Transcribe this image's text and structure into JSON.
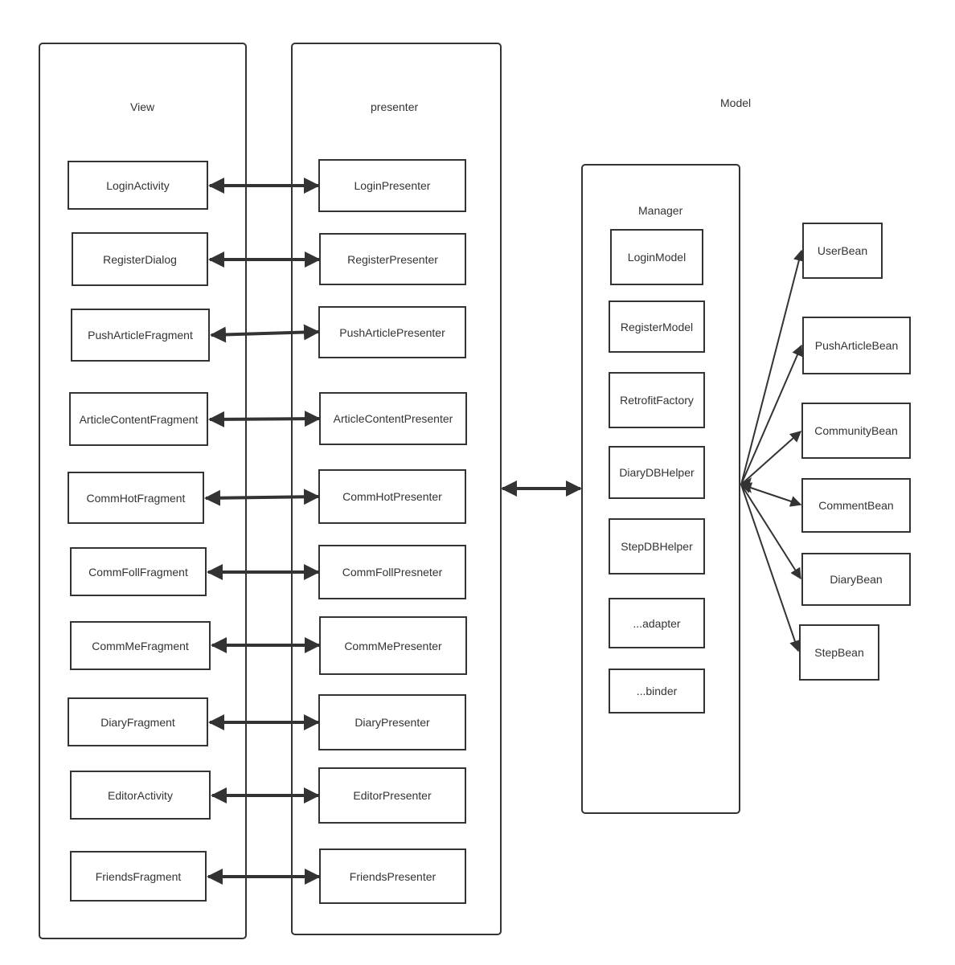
{
  "lanes": {
    "view": {
      "title": "View"
    },
    "presenter": {
      "title": "presenter"
    },
    "model": {
      "title": "Model"
    },
    "manager": {
      "title": "Manager"
    }
  },
  "view_items": [
    "LoginActivity",
    "RegisterDialog",
    "PushArticleFragment",
    "ArticleContentFragment",
    "CommHotFragment",
    "CommFollFragment",
    "CommMeFragment",
    "DiaryFragment",
    "EditorActivity",
    "FriendsFragment"
  ],
  "presenter_items": [
    "LoginPresenter",
    "RegisterPresenter",
    "PushArticlePresenter",
    "ArticleContentPresenter",
    "CommHotPresenter",
    "CommFollPresneter",
    "CommMePresenter",
    "DiaryPresenter",
    "EditorPresenter",
    "FriendsPresenter"
  ],
  "manager_items": [
    "LoginModel",
    "RegisterModel",
    "RetrofitFactory",
    "DiaryDBHelper",
    "StepDBHelper",
    "...adapter",
    "...binder"
  ],
  "bean_items": [
    "UserBean",
    "PushArticleBean",
    "CommunityBean",
    "CommentBean",
    "DiaryBean",
    "StepBean"
  ],
  "colors": {
    "stroke": "#333333",
    "background": "#ffffff"
  }
}
